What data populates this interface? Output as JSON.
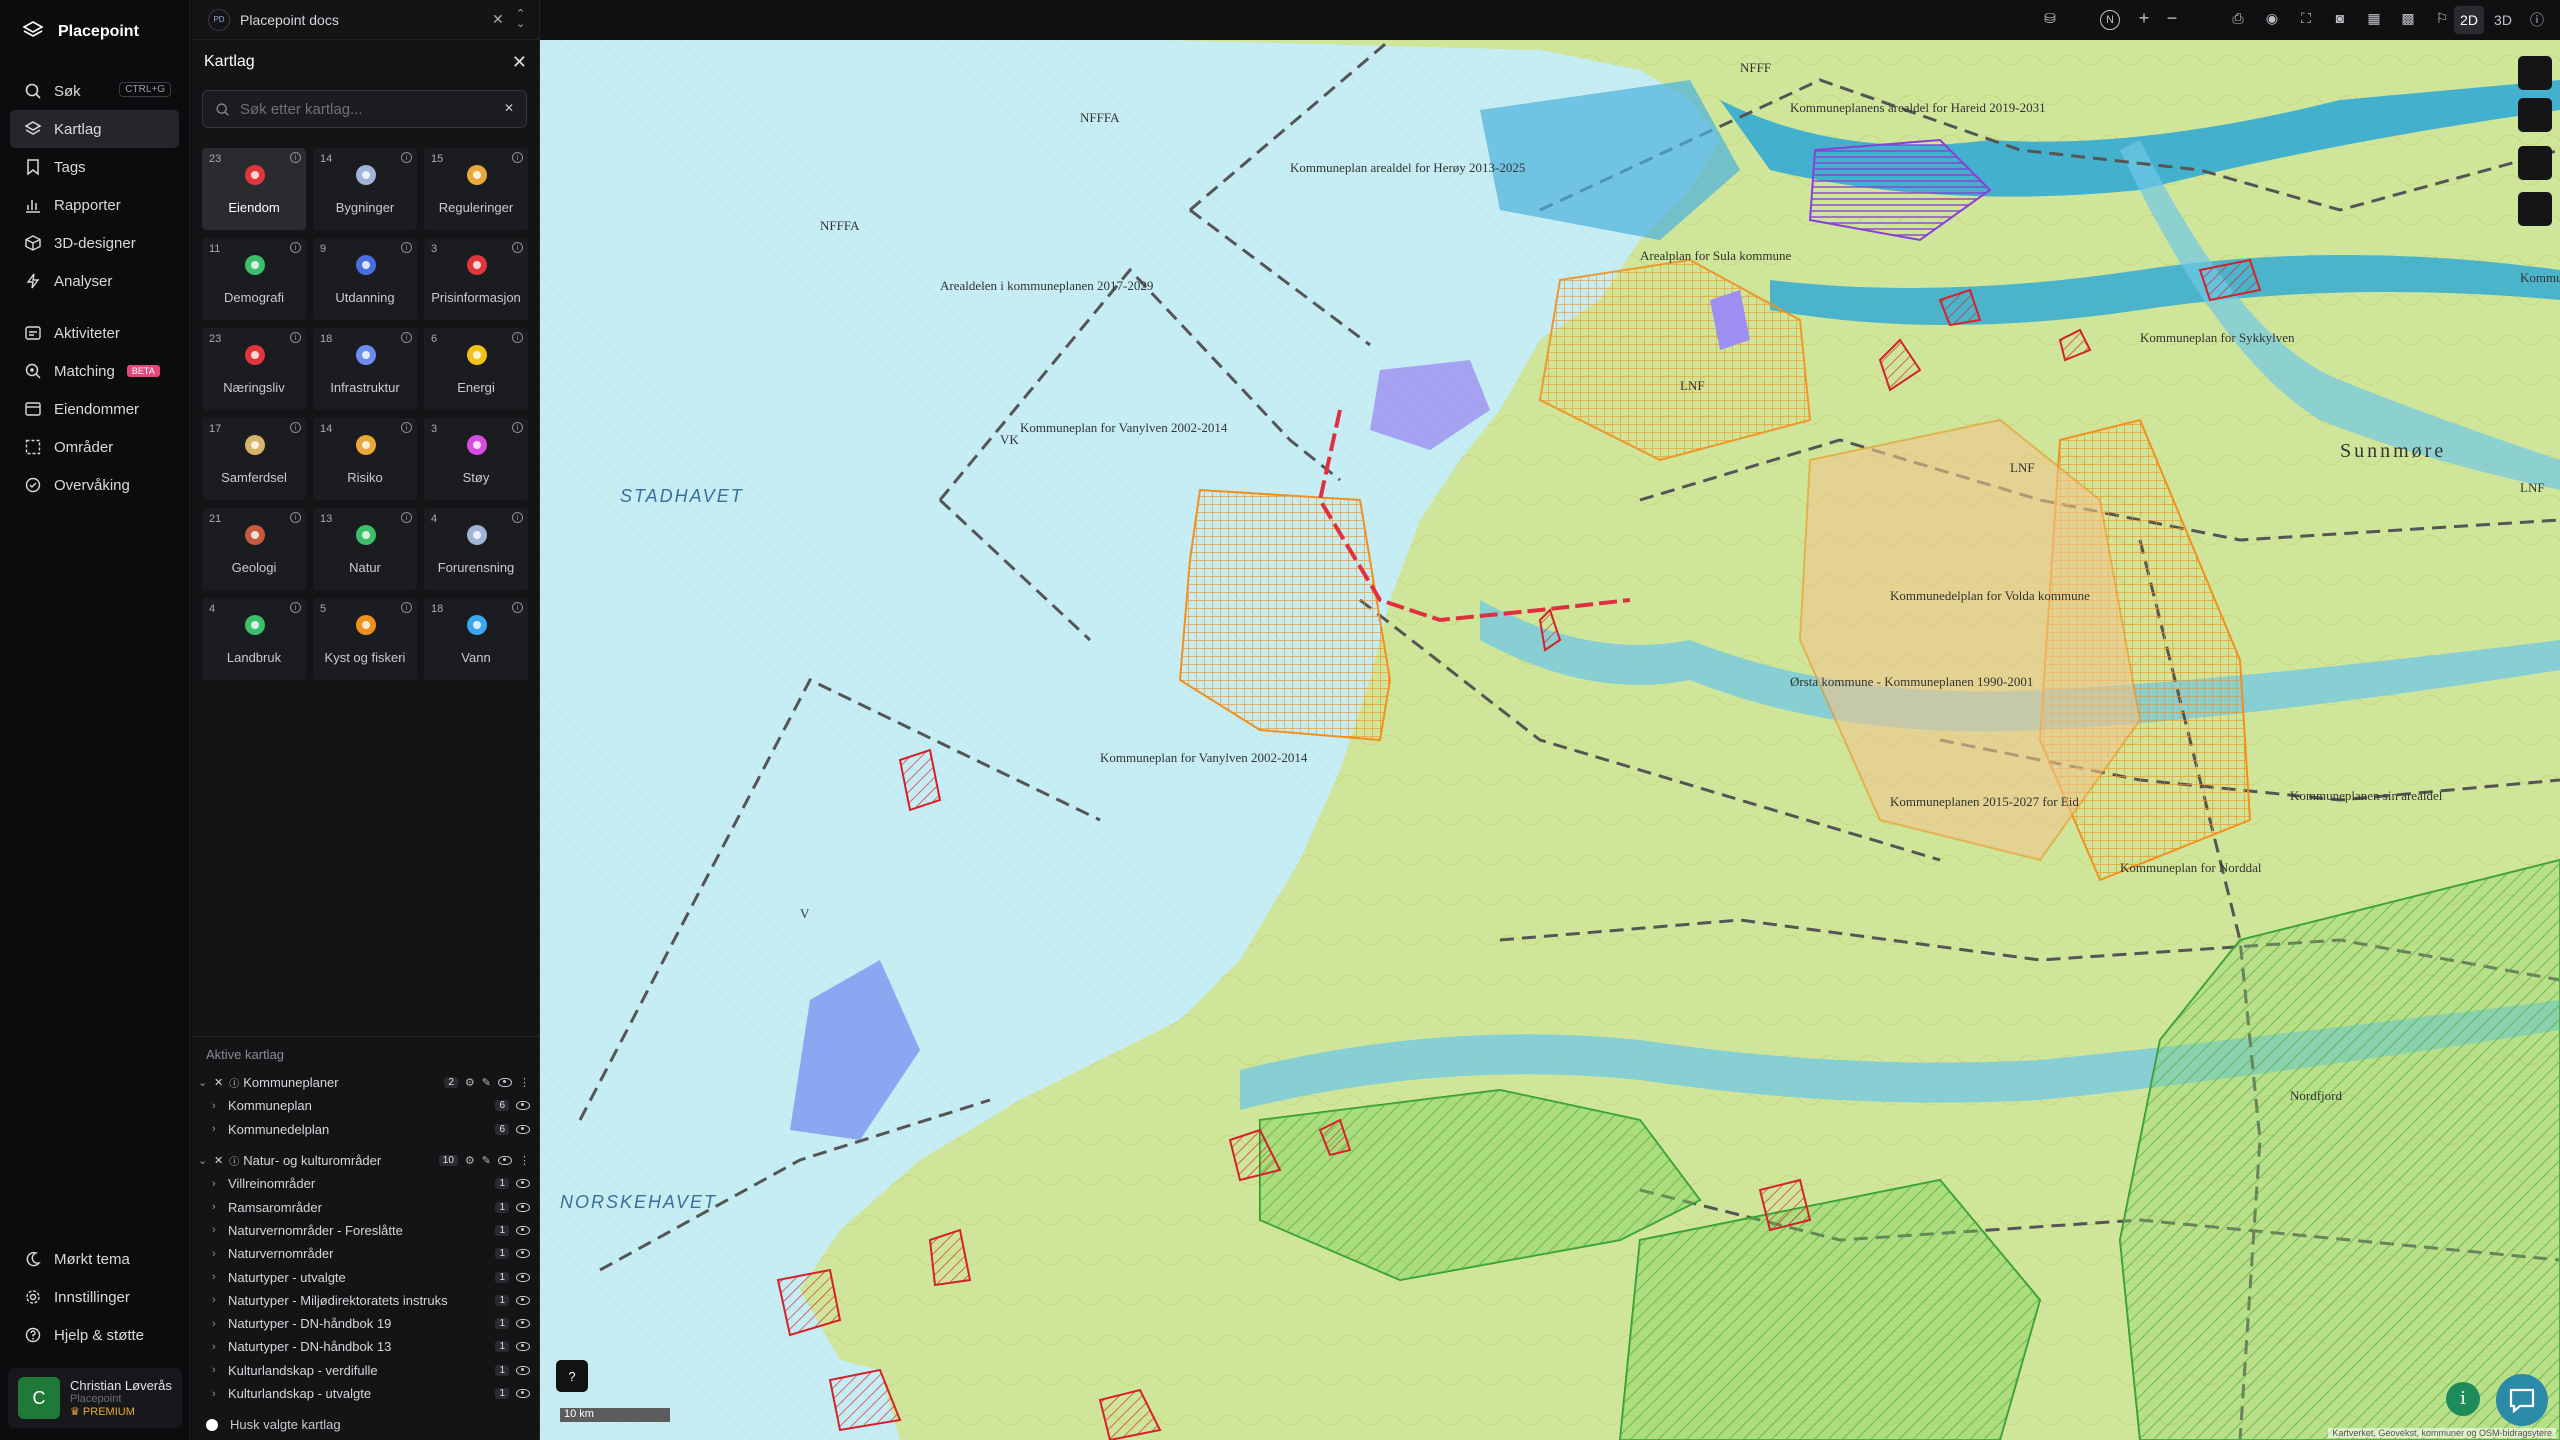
{
  "app": {
    "name": "Placepoint"
  },
  "nav": {
    "items": [
      {
        "label": "Søk",
        "shortcut": "CTRL+G"
      },
      {
        "label": "Kartlag"
      },
      {
        "label": "Tags"
      },
      {
        "label": "Rapporter"
      },
      {
        "label": "3D-designer"
      },
      {
        "label": "Analyser"
      },
      {
        "label": "Aktiviteter"
      },
      {
        "label": "Matching",
        "badge": "BETA"
      },
      {
        "label": "Eiendommer"
      },
      {
        "label": "Områder"
      },
      {
        "label": "Overvåking"
      }
    ],
    "bottom": [
      {
        "label": "Mørkt tema"
      },
      {
        "label": "Innstillinger"
      },
      {
        "label": "Hjelp & støtte"
      }
    ],
    "user": {
      "initial": "C",
      "name": "Christian Løverås",
      "org": "Placepoint",
      "plan": "PREMIUM"
    }
  },
  "tab": {
    "badge": "PD",
    "title": "Placepoint docs"
  },
  "panel": {
    "title": "Kartlag",
    "search_placeholder": "Søk etter kartlag...",
    "categories": [
      {
        "count": "23",
        "label": "Eiendom",
        "icon": "pin-icon",
        "selected": true
      },
      {
        "count": "14",
        "label": "Bygninger",
        "icon": "building-icon"
      },
      {
        "count": "15",
        "label": "Reguleringer",
        "icon": "crane-icon"
      },
      {
        "count": "11",
        "label": "Demografi",
        "icon": "demografi-icon"
      },
      {
        "count": "9",
        "label": "Utdanning",
        "icon": "graduation-cap-icon"
      },
      {
        "count": "3",
        "label": "Prisinformasjon",
        "icon": "shopping-bag-icon"
      },
      {
        "count": "23",
        "label": "Næringsliv",
        "icon": "briefcase-icon"
      },
      {
        "count": "18",
        "label": "Infrastruktur",
        "icon": "globe-icon"
      },
      {
        "count": "6",
        "label": "Energi",
        "icon": "lightning-icon"
      },
      {
        "count": "17",
        "label": "Samferdsel",
        "icon": "bus-icon"
      },
      {
        "count": "14",
        "label": "Risiko",
        "icon": "hazard-icon"
      },
      {
        "count": "3",
        "label": "Støy",
        "icon": "noise-icon"
      },
      {
        "count": "21",
        "label": "Geologi",
        "icon": "terrain-icon"
      },
      {
        "count": "13",
        "label": "Natur",
        "icon": "leaf-icon"
      },
      {
        "count": "4",
        "label": "Forurensning",
        "icon": "factory-icon"
      },
      {
        "count": "4",
        "label": "Landbruk",
        "icon": "sprout-icon"
      },
      {
        "count": "5",
        "label": "Kyst og fiskeri",
        "icon": "fish-icon"
      },
      {
        "count": "18",
        "label": "Vann",
        "icon": "water-drop-icon"
      }
    ],
    "active_title": "Aktive kartlag",
    "groups": [
      {
        "name": "Kommuneplaner",
        "count": "2",
        "layers": [
          {
            "name": "Kommuneplan",
            "count": "6"
          },
          {
            "name": "Kommunedelplan",
            "count": "6"
          }
        ]
      },
      {
        "name": "Natur- og kulturområder",
        "count": "10",
        "layers": [
          {
            "name": "Villreinområder",
            "count": "1"
          },
          {
            "name": "Ramsarområder",
            "count": "1"
          },
          {
            "name": "Naturvernområder - Foreslåtte",
            "count": "1"
          },
          {
            "name": "Naturvernområder",
            "count": "1"
          },
          {
            "name": "Naturtyper - utvalgte",
            "count": "1"
          },
          {
            "name": "Naturtyper - Miljødirektoratets instruks",
            "count": "1"
          },
          {
            "name": "Naturtyper - DN-håndbok 19",
            "count": "1"
          },
          {
            "name": "Naturtyper - DN-håndbok 13",
            "count": "1"
          },
          {
            "name": "Kulturlandskap - verdifulle",
            "count": "1"
          },
          {
            "name": "Kulturlandskap - utvalgte",
            "count": "1"
          }
        ]
      }
    ],
    "remember_label": "Husk valgte kartlag"
  },
  "toolbar": {
    "north": "N",
    "plus": "+",
    "minus": "−",
    "mode_2d": "2D",
    "mode_3d": "3D"
  },
  "map": {
    "labels": [
      "NFFF",
      "NFFFA",
      "NFFFA",
      "Kommuneplan arealdel for Herøy 2013-2025",
      "Kommuneplanens arealdel for Hareid 2019-2031",
      "Arealplan for Sula kommune",
      "Kommuneplan for Sykkylven",
      "Arealdelen i kommuneplanen 2017-2029",
      "Kommuneplan for Vanylven 2002-2014",
      "Kommuneplan for Vanylven 2002-2014",
      "Kommunedelplan for Volda kommune",
      "Kommuneplanen 2015-2027 for Eid",
      "Sunnmøre",
      "Kommuneplanen sin arealdel",
      "Ørsta kommune - Kommuneplanen 1990-2001",
      "V",
      "VK",
      "LNF",
      "LNF",
      "LNF",
      "Kommuneplan for Stranda",
      "Kommuneplan for Norddal",
      "Nordfjord"
    ],
    "seas": [
      "STADHAVET",
      "NORSKEHAVET"
    ],
    "scale": "10 km",
    "attribution": "Kartverket, Geovekst, kommuner og OSM-bidragsytere"
  }
}
